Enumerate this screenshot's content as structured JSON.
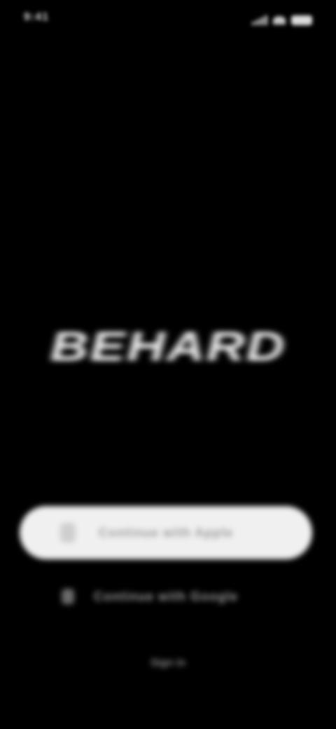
{
  "status_bar": {
    "time": "9:41",
    "icons": [
      "signal-icon",
      "wifi-icon",
      "battery-icon"
    ]
  },
  "logo": {
    "text": "BEHARD",
    "color": "#f2f2f2"
  },
  "actions": {
    "primary": {
      "label": "Continue with Apple",
      "icon": "apple-icon",
      "background": "#f0f0f0"
    },
    "secondary": {
      "label": "Continue with Google",
      "icon": "google-icon"
    },
    "footer_link": "Sign in"
  },
  "theme": {
    "background": "#000000"
  }
}
